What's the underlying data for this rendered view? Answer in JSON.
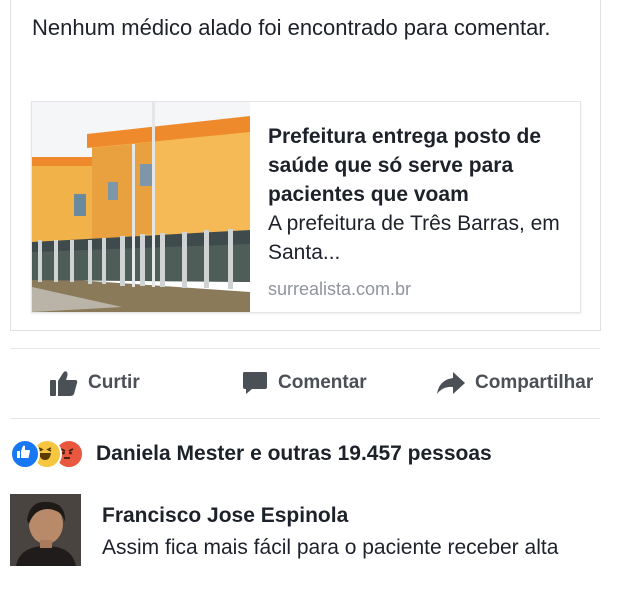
{
  "post": {
    "text": "Nenhum médico alado foi encontrado para comentar."
  },
  "link": {
    "title": "Prefeitura entrega posto de saúde que só serve para pacientes que voam",
    "description": "A prefeitura de Três Barras, em Santa...",
    "domain": "surrealista.com.br",
    "thumbnail_icon": "building-on-stilts-photo"
  },
  "actions": {
    "like_label": "Curtir",
    "comment_label": "Comentar",
    "share_label": "Compartilhar"
  },
  "reactions": {
    "icons": [
      "like-icon",
      "haha-icon",
      "angry-icon"
    ],
    "summary": "Daniela Mester e outras 19.457 pessoas"
  },
  "comment": {
    "author": "Francisco Jose Espinola",
    "text": "Assim fica mais fácil para o paciente receber alta"
  },
  "colors": {
    "text": "#1d2129",
    "muted": "#90949c",
    "action": "#4b4f56",
    "like_blue": "#1877f2",
    "haha_yellow": "#f7c640",
    "angry_red": "#e9573f"
  }
}
